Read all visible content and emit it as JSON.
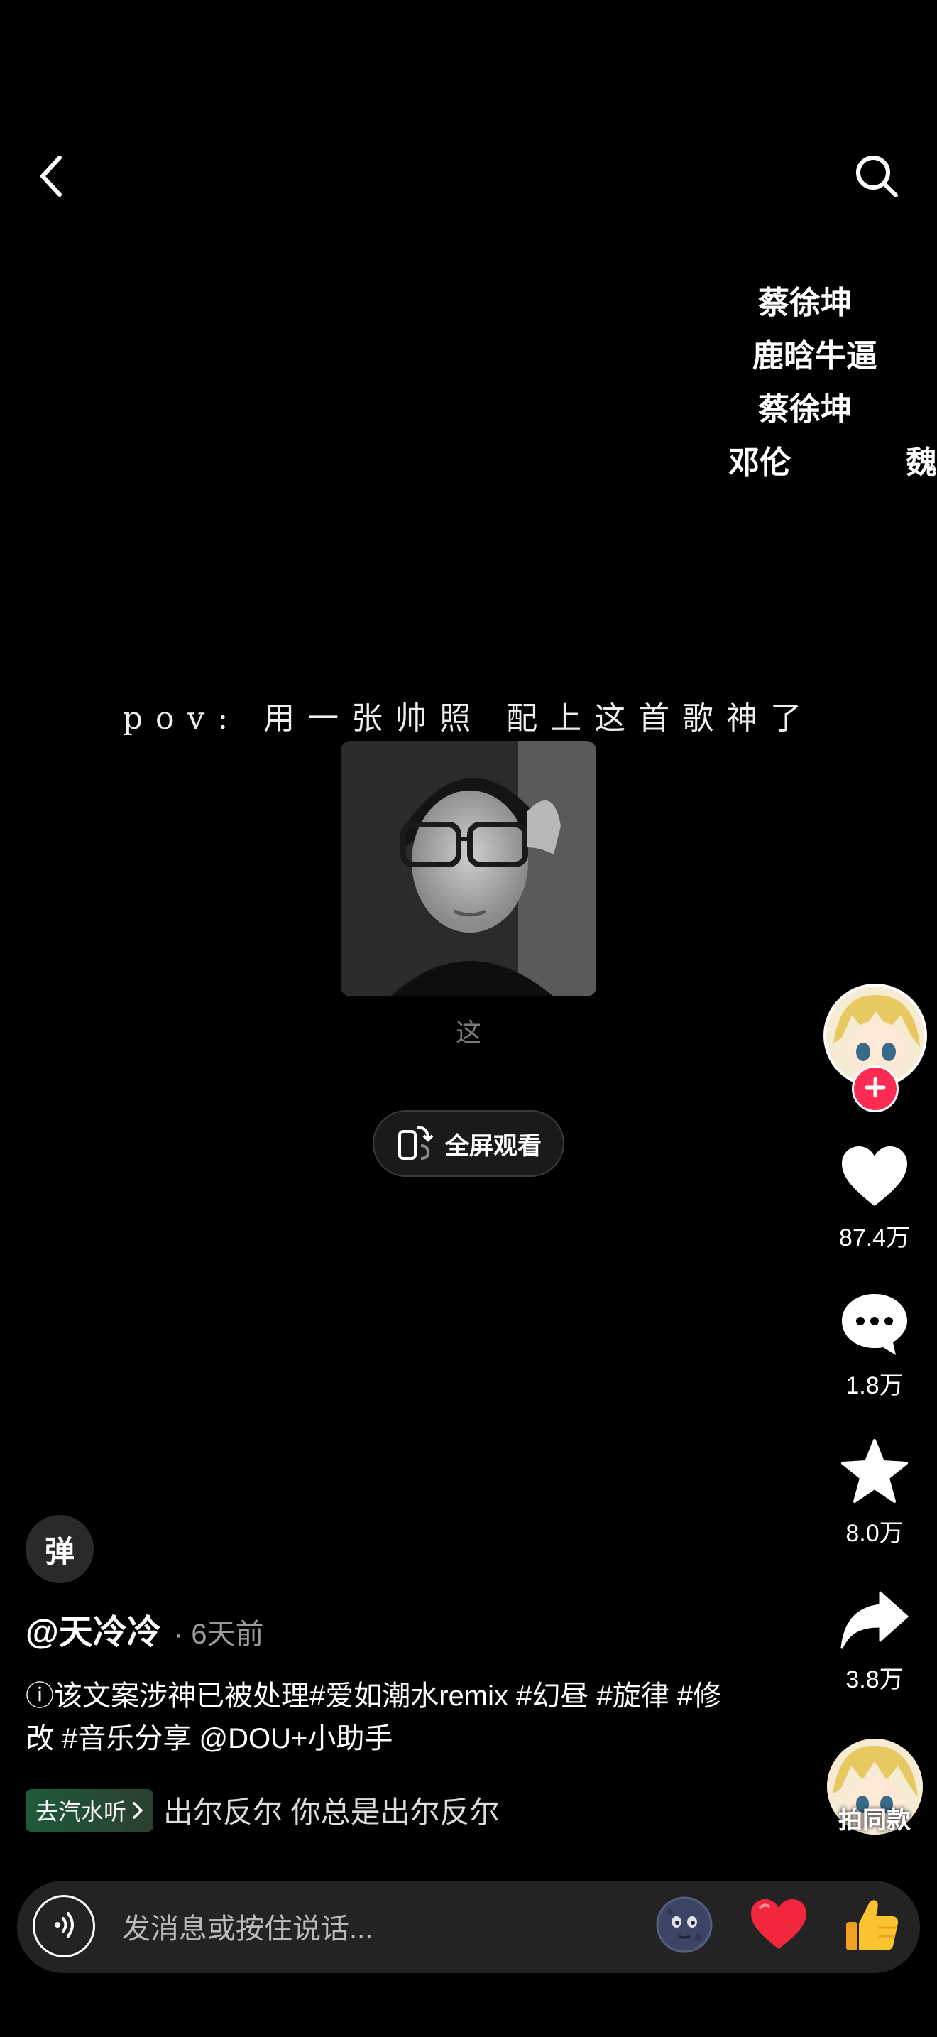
{
  "top_bar": {
    "back_icon": "chevron-left-icon",
    "search_icon": "search-icon"
  },
  "danmaku": [
    {
      "text": "蔡徐坤"
    },
    {
      "text": "鹿晗牛逼"
    },
    {
      "text": "蔡徐坤"
    },
    {
      "text": "邓伦"
    },
    {
      "text": "魏"
    }
  ],
  "video": {
    "caption": "pov: 用一张帅照 配上这首歌神了",
    "lyric_char": "这",
    "fullscreen_label": "全屏观看"
  },
  "rail": {
    "likes": "87.4万",
    "comments": "1.8万",
    "favorites": "8.0万",
    "shares": "3.8万",
    "same_style_label": "拍同款"
  },
  "info": {
    "danmu_toggle": "弹",
    "author": "@天冷冷",
    "post_time": "· 6天前",
    "description": "ⓘ该文案涉神已被处理#爱如潮水remix #幻昼 #旋律 #修改 #音乐分享 @DOU+小助手",
    "qishui_badge": "去汽水听",
    "music_text": "出尔反尔   你总是出尔反尔"
  },
  "input": {
    "placeholder": "发消息或按住说话..."
  },
  "colors": {
    "accent": "#fe2c55",
    "background": "#000000"
  }
}
